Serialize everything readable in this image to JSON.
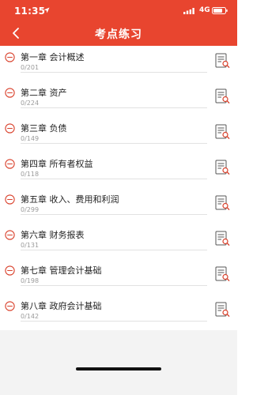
{
  "status_bar": {
    "time": "11:35",
    "network": "4G"
  },
  "nav": {
    "title": "考点练习"
  },
  "chapters": [
    {
      "title": "第一章 会计概述",
      "progress": "0/201"
    },
    {
      "title": "第二章 资产",
      "progress": "0/224"
    },
    {
      "title": "第三章 负债",
      "progress": "0/149"
    },
    {
      "title": "第四章 所有者权益",
      "progress": "0/118"
    },
    {
      "title": "第五章 收入、费用和利润",
      "progress": "0/299"
    },
    {
      "title": "第六章 财务报表",
      "progress": "0/131"
    },
    {
      "title": "第七章 管理会计基础",
      "progress": "0/198"
    },
    {
      "title": "第八章 政府会计基础",
      "progress": "0/142"
    }
  ],
  "colors": {
    "brand": "#e8452f",
    "icon_red": "#d9402b",
    "divider": "#e2e2e2",
    "bottom_bg": "#f3f3f3"
  },
  "icons": {
    "back": "chevron-left-icon",
    "chapter_marker": "collapse-circle-icon",
    "practice": "document-search-icon"
  }
}
